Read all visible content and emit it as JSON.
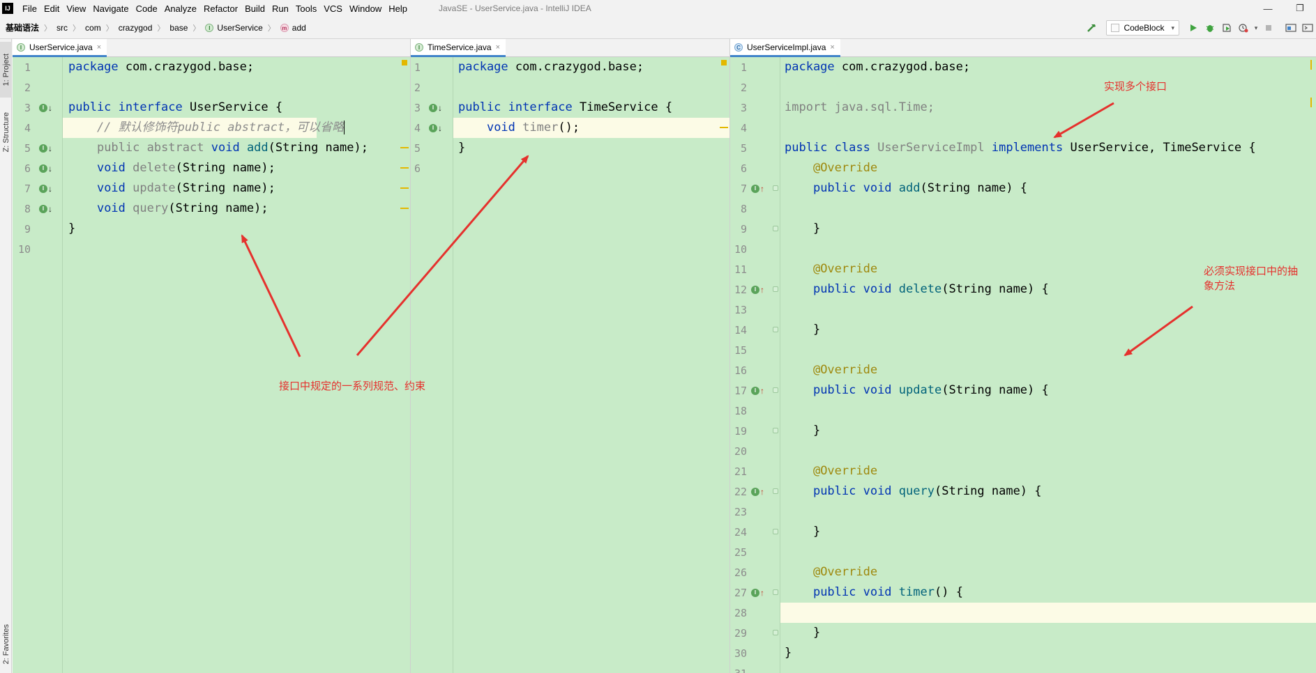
{
  "app": {
    "title": "JavaSE - UserService.java - IntelliJ IDEA",
    "logo_text": "IJ",
    "menu": [
      "File",
      "Edit",
      "View",
      "Navigate",
      "Code",
      "Analyze",
      "Refactor",
      "Build",
      "Run",
      "Tools",
      "VCS",
      "Window",
      "Help"
    ]
  },
  "window_controls": {
    "minimize": "—",
    "restore": "❐"
  },
  "breadcrumb": [
    {
      "label": "基础语法",
      "icon": ""
    },
    {
      "label": "src",
      "icon": ""
    },
    {
      "label": "com",
      "icon": ""
    },
    {
      "label": "crazygod",
      "icon": ""
    },
    {
      "label": "base",
      "icon": ""
    },
    {
      "label": "UserService",
      "icon": "I"
    },
    {
      "label": "add",
      "icon": "m"
    }
  ],
  "toolbar": {
    "run_config": "CodeBlock",
    "run_config_arrow": "▾"
  },
  "side_tabs": {
    "project": "1: Project",
    "structure": "Z: Structure",
    "favorites": "2: Favorites"
  },
  "tabs": {
    "pane1": {
      "label": "UserService.java",
      "icon": "I",
      "close": "×"
    },
    "pane2": {
      "label": "TimeService.java",
      "icon": "I",
      "close": "×"
    },
    "pane3": {
      "label": "UserServiceImpl.java",
      "icon": "C",
      "close": "×"
    }
  },
  "code": {
    "pane1": [
      "package com.crazygod.base;",
      "",
      "public interface UserService {",
      "    // 默认修饰符public abstract，可以省略",
      "    public abstract void add(String name);",
      "    void delete(String name);",
      "    void update(String name);",
      "    void query(String name);",
      "}",
      ""
    ],
    "pane2": [
      "package com.crazygod.base;",
      "",
      "public interface TimeService {",
      "    void timer();",
      "}",
      ""
    ],
    "pane3": [
      "package com.crazygod.base;",
      "",
      "import java.sql.Time;",
      "",
      "public class UserServiceImpl implements UserService, TimeService {",
      "    @Override",
      "    public void add(String name) {",
      "",
      "    }",
      "",
      "    @Override",
      "    public void delete(String name) {",
      "",
      "    }",
      "",
      "    @Override",
      "    public void update(String name) {",
      "",
      "    }",
      "",
      "    @Override",
      "    public void query(String name) {",
      "",
      "    }",
      "",
      "    @Override",
      "    public void timer() {",
      "",
      "    }",
      "}",
      ""
    ]
  },
  "annotations": {
    "note_interface": "接口中规定的一系列规范、约束",
    "note_multi": "实现多个接口",
    "note_must_line1": "必须实现接口中的抽",
    "note_must_line2": "象方法",
    "color": "#e5312d"
  },
  "colors": {
    "editor_bg": "#c8ebc8",
    "keyword": "#0033b3",
    "method": "#00627a",
    "annotation": "#9e880d",
    "tab_underline": "#4083c9"
  }
}
